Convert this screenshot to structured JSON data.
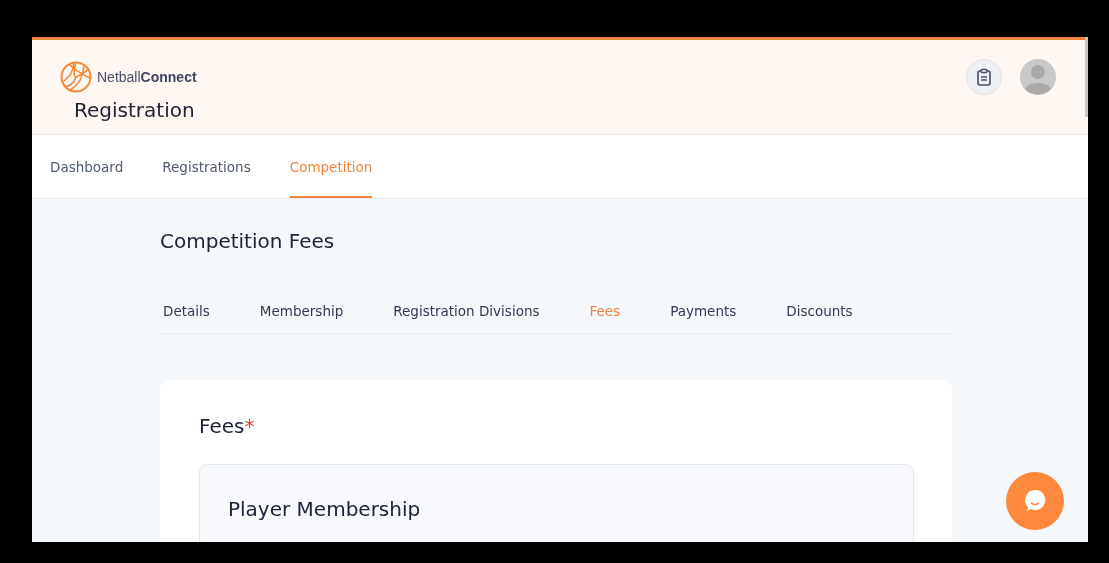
{
  "header": {
    "logo_text_light": "Netball",
    "logo_text_bold": "Connect",
    "title": "Registration"
  },
  "nav_tabs": [
    {
      "label": "Dashboard",
      "selected": false
    },
    {
      "label": "Registrations",
      "selected": false
    },
    {
      "label": "Competition",
      "selected": true
    }
  ],
  "page_title": "Competition Fees",
  "sub_tabs": [
    {
      "label": "Details",
      "selected": false
    },
    {
      "label": "Membership",
      "selected": false
    },
    {
      "label": "Registration Divisions",
      "selected": false
    },
    {
      "label": "Fees",
      "selected": true
    },
    {
      "label": "Payments",
      "selected": false
    },
    {
      "label": "Discounts",
      "selected": false
    }
  ],
  "card": {
    "title": "Fees",
    "required_mark": "*",
    "section_title": "Player Membership"
  }
}
